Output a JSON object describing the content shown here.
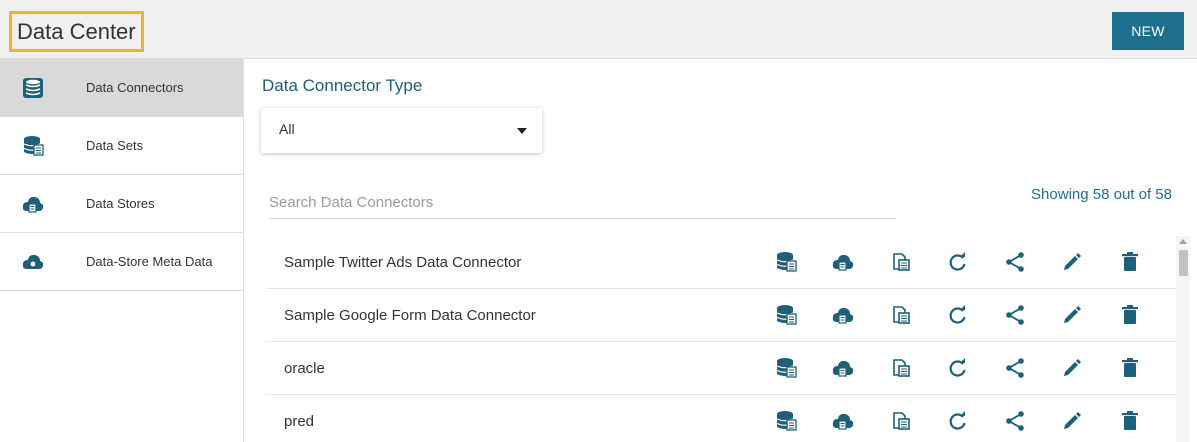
{
  "header": {
    "title": "Data Center",
    "new_label": "NEW"
  },
  "sidebar": {
    "items": [
      {
        "label": "Data Connectors",
        "icon": "database-icon",
        "active": true
      },
      {
        "label": "Data Sets",
        "icon": "dataset-icon",
        "active": false
      },
      {
        "label": "Data Stores",
        "icon": "cloud-store-icon",
        "active": false
      },
      {
        "label": "Data-Store Meta Data",
        "icon": "cloud-meta-icon",
        "active": false
      }
    ]
  },
  "main": {
    "section_title": "Data Connector Type",
    "filter": {
      "selected": "All"
    },
    "search": {
      "placeholder": "Search Data Connectors",
      "value": ""
    },
    "showing": "Showing 58 out of 58",
    "rows": [
      {
        "name": "Sample Twitter Ads Data Connector"
      },
      {
        "name": "Sample Google Form Data Connector"
      },
      {
        "name": "oracle"
      },
      {
        "name": "pred"
      }
    ],
    "row_actions": [
      "create-dataset-icon",
      "create-datastore-icon",
      "copy-icon",
      "refresh-icon",
      "share-icon",
      "edit-icon",
      "delete-icon"
    ]
  },
  "colors": {
    "accent": "#1e6f8d",
    "title_highlight": "#f0b429",
    "active_bg": "#d9d9d9"
  }
}
